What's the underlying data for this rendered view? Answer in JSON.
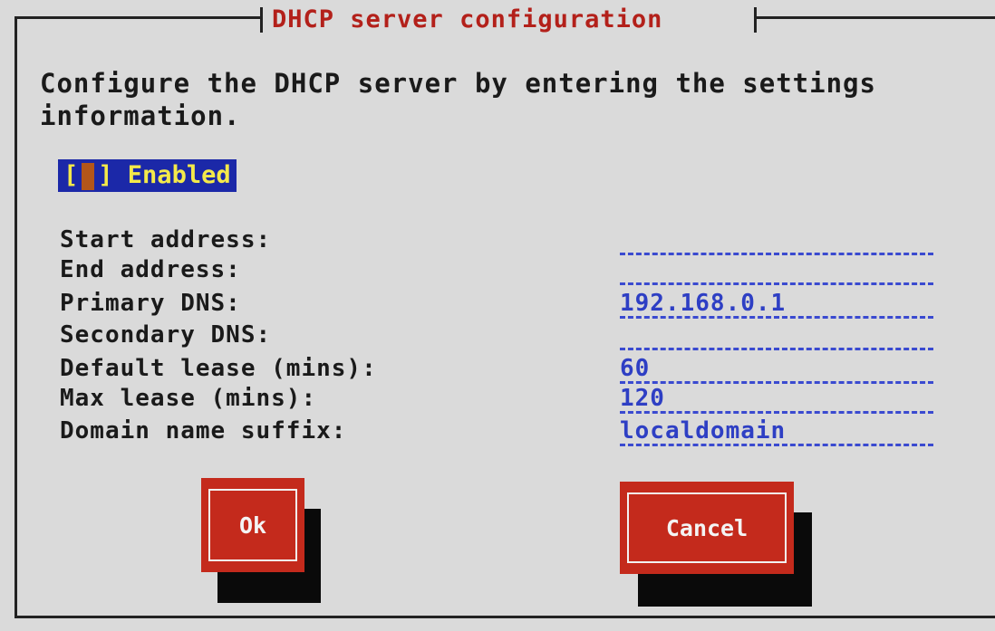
{
  "dialog": {
    "title": "DHCP server configuration",
    "description": "Configure the DHCP server by entering the settings\ninformation."
  },
  "enabled": {
    "label": "Enabled",
    "checked": false,
    "prefix": "[",
    "suffix": "]"
  },
  "fields": [
    {
      "label": "Start address:",
      "value": ""
    },
    {
      "label": "End address:",
      "value": ""
    },
    {
      "label": "Primary DNS:",
      "value": "192.168.0.1"
    },
    {
      "label": "Secondary DNS:",
      "value": ""
    },
    {
      "label": "Default lease (mins):",
      "value": "60"
    },
    {
      "label": "Max lease (mins):",
      "value": "120"
    },
    {
      "label": "Domain name suffix:",
      "value": "localdomain"
    }
  ],
  "buttons": {
    "ok": "Ok",
    "cancel": "Cancel"
  },
  "colors": {
    "background": "#dadada",
    "title": "#b3201a",
    "field_text": "#2e3fc4",
    "checkbox_bg": "#1b28a8",
    "checkbox_text": "#f4e94a",
    "button_bg": "#c42a1c"
  }
}
